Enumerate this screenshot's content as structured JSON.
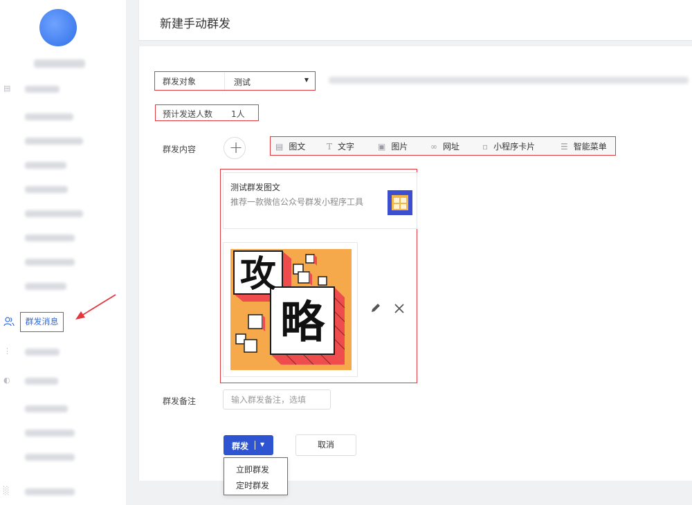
{
  "page": {
    "title": "新建手动群发"
  },
  "sidebar": {
    "group_message_label": "群发消息"
  },
  "form": {
    "target_label": "群发对象",
    "target_value": "测试",
    "estimate_label": "预计发送人数",
    "estimate_value": "1人",
    "content_label": "群发内容",
    "note_label": "群发备注",
    "note_placeholder": "输入群发备注，选填"
  },
  "toolbar": [
    {
      "icon": "image-text-icon",
      "label": "图文"
    },
    {
      "icon": "text-icon",
      "label": "文字"
    },
    {
      "icon": "picture-icon",
      "label": "图片"
    },
    {
      "icon": "link-icon",
      "label": "网址"
    },
    {
      "icon": "miniprogram-card-icon",
      "label": "小程序卡片"
    },
    {
      "icon": "menu-list-icon",
      "label": "智能菜单"
    }
  ],
  "article": {
    "title": "测试群发图文",
    "description": "推荐一款微信公众号群发小程序工具"
  },
  "cover": {
    "char1": "攻",
    "char2": "略"
  },
  "actions": {
    "send_label": "群发",
    "cancel_label": "取消",
    "menu": [
      "立即群发",
      "定时群发"
    ]
  },
  "colors": {
    "primary": "#2e54d1",
    "annotation": "#e2373d",
    "cover_bg": "#f6a94b"
  }
}
